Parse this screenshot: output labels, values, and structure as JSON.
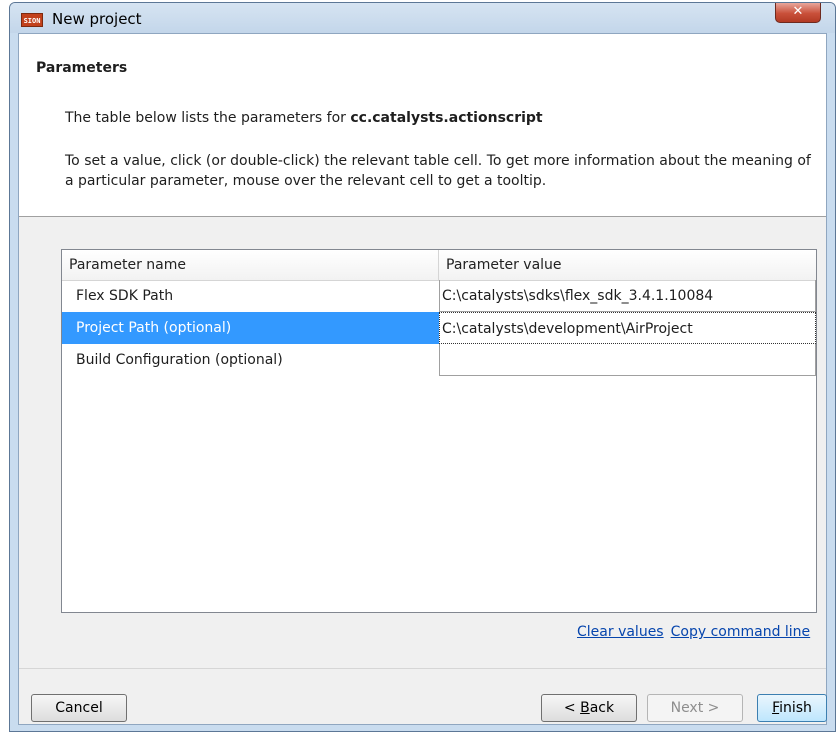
{
  "window": {
    "icon_text": "SION",
    "title": "New project",
    "close_label": "✕"
  },
  "header": {
    "title": "Parameters",
    "description_prefix": "The table below lists the parameters for ",
    "description_subject": "cc.catalysts.actionscript",
    "instructions": "To set a value, click (or double-click) the relevant table cell. To get more information about the meaning of a particular parameter, mouse over the relevant cell to get a tooltip."
  },
  "table": {
    "columns": [
      "Parameter name",
      "Parameter value"
    ],
    "rows": [
      {
        "name": "Flex SDK Path",
        "value": "C:\\catalysts\\sdks\\flex_sdk_3.4.1.10084"
      },
      {
        "name": "Project Path (optional)",
        "value": "C:\\catalysts\\development\\AirProject"
      },
      {
        "name": "Build Configuration (optional)",
        "value": ""
      }
    ],
    "selected_row": 1
  },
  "links": {
    "clear_values": "Clear values",
    "copy_command_line": "Copy command line"
  },
  "buttons": {
    "cancel": "Cancel",
    "back_prefix": "< ",
    "back_mnemonic": "B",
    "back_rest": "ack",
    "next": "Next >",
    "finish_mnemonic": "F",
    "finish_rest": "inish"
  }
}
